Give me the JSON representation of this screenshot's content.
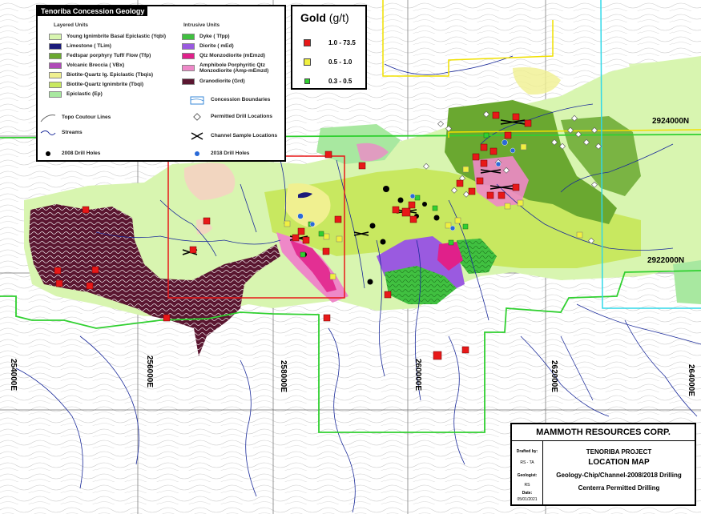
{
  "legend": {
    "title": "Tenoriba Concession Geology",
    "layered_header": "Layered Units",
    "intrusive_header": "Intrusive Units",
    "layered": [
      {
        "label": "Young Ignimbrite Basal Epiclastic (Yqbi)",
        "color": "#d8f5b0"
      },
      {
        "label": "Limestone ( TLim)",
        "color": "#1a1a7a"
      },
      {
        "label": "Fedlspar porphyry Tuff/ Flow (Tfp)",
        "color": "#6aa830"
      },
      {
        "label": "Volcanic Breccia ( VBx)",
        "color": "#b04ab8"
      },
      {
        "label": "Biotite-Quartz Ig. Epiclastic (Tbqis)",
        "color": "#f0f090"
      },
      {
        "label": "Biotite-Quartz Ignimbrite (Tbqi)",
        "color": "#c8e860"
      },
      {
        "label": "Epiclastic (Ep)",
        "color": "#a8e8a0"
      }
    ],
    "intrusive": [
      {
        "label": "Dyke ( Tfpp)",
        "color": "#40c040"
      },
      {
        "label": "Diorite ( mEd)",
        "color": "#9a5ae0"
      },
      {
        "label": "Qtz Monzodiorite (mEmzd)",
        "color": "#e0208a"
      },
      {
        "label": "Amphibole Porphyritic Qtz Monzodiorite (Amp-mEmzd)",
        "color": "#ee88c8"
      },
      {
        "label": "Granodiorite (Grd)",
        "color": "#5a1630"
      }
    ],
    "symbols_left": [
      "Topo Coutour Lines",
      "Streams",
      "2008 Drill Holes"
    ],
    "symbols_right": [
      "Concession Boundaries",
      "Permitted Drill Locations",
      "Channel Sample Locations",
      "2018 Drill Holes"
    ]
  },
  "gold_legend": {
    "title": "Gold",
    "unit": "(g/t)",
    "classes": [
      {
        "label": "1.0 - 73.5",
        "color": "#e81818"
      },
      {
        "label": "0.5 - 1.0",
        "color": "#f0f040"
      },
      {
        "label": "0.3 - 0.5",
        "color": "#30d030"
      }
    ]
  },
  "title_block": {
    "company": "MAMMOTH RESOURCES CORP.",
    "project": "TENORIBA PROJECT",
    "map_title": "LOCATION MAP",
    "subtitle1": "Geology-Chip/Channel-2008/2018 Drilling",
    "subtitle2": "Centerra Permitted Drilling",
    "drafted_label": "Drafted by:",
    "drafted": "RS - TA",
    "geologist_label": "Geologist:",
    "geologist": "RS",
    "date_label": "Date:",
    "date": "05/01/2021"
  },
  "coordinates": {
    "northing": [
      "2924000N",
      "2922000N"
    ],
    "easting": [
      "254000E",
      "256000E",
      "258000E",
      "260000E",
      "262000E",
      "264000E"
    ]
  }
}
